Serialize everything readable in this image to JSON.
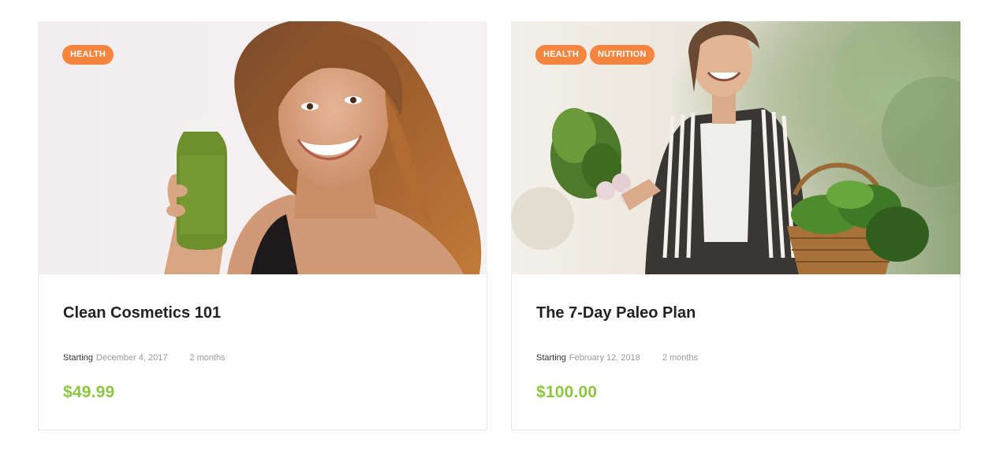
{
  "cards": [
    {
      "tags": [
        "HEALTH"
      ],
      "title": "Clean Cosmetics 101",
      "starting_label": "Starting",
      "date": "December 4, 2017",
      "duration": "2 months",
      "price": "$49.99",
      "image_alt": "woman holding green juice bottle"
    },
    {
      "tags": [
        "HEALTH",
        "NUTRITION"
      ],
      "title": "The 7-Day Paleo Plan",
      "starting_label": "Starting",
      "date": "February 12, 2018",
      "duration": "2 months",
      "price": "$100.00",
      "image_alt": "woman carrying basket of fresh vegetables"
    }
  ],
  "colors": {
    "tag_bg": "#f5843e",
    "price": "#8cc63f",
    "title": "#222222",
    "border": "#e6e6e6"
  }
}
